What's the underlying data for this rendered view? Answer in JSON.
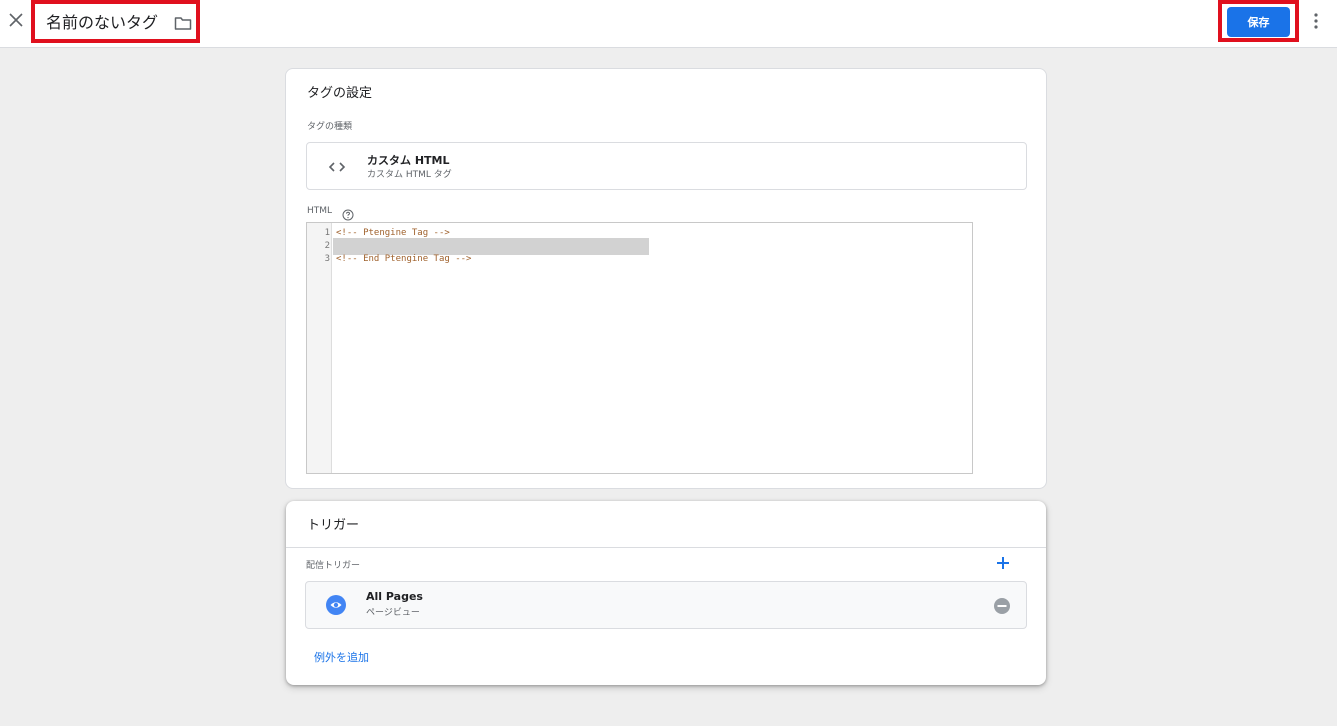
{
  "header": {
    "close_icon": "close-icon",
    "title": "名前のないタグ",
    "folder_icon": "folder-icon",
    "save_label": "保存",
    "more_icon": "more-vert-icon"
  },
  "tag_config": {
    "title": "タグの設定",
    "tag_type_label": "タグの種類",
    "tag_type": {
      "icon": "code-icon",
      "name": "カスタム HTML",
      "description": "カスタム HTML タグ"
    },
    "html_label": "HTML",
    "help_icon": "help-icon",
    "editor": {
      "lines": [
        {
          "number": "1",
          "text": "<!-- Ptengine Tag -->"
        },
        {
          "number": "2",
          "text": ""
        },
        {
          "number": "3",
          "text": "<!-- End Ptengine Tag -->"
        }
      ]
    }
  },
  "triggers": {
    "title": "トリガー",
    "firing_label": "配信トリガー",
    "add_icon": "plus-icon",
    "items": [
      {
        "icon": "eye-icon",
        "name": "All Pages",
        "type": "ページビュー",
        "remove_icon": "remove-circle-icon"
      }
    ],
    "add_exception_label": "例外を追加"
  },
  "colors": {
    "accent": "#1a73e8",
    "highlight_border": "#e0101e",
    "code_text": "#a0622d"
  }
}
